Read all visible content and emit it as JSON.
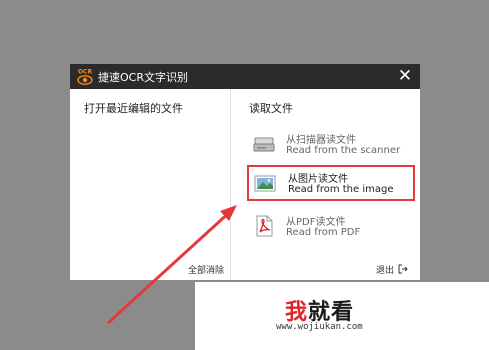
{
  "window": {
    "logo_text": "OCR",
    "title": "捷速OCR文字识别",
    "close_label": "✕"
  },
  "left_pane": {
    "heading": "打开最近编辑的文件",
    "clear_all_label": "全部消除"
  },
  "right_pane": {
    "heading": "读取文件",
    "options": [
      {
        "label_cn": "从扫描器读文件",
        "label_en": "Read from the scanner",
        "icon": "scanner-icon",
        "selected": false
      },
      {
        "label_cn": "从图片读文件",
        "label_en": "Read from the image",
        "icon": "image-icon",
        "selected": true
      },
      {
        "label_cn": "从PDF读文件",
        "label_en": "Read from PDF",
        "icon": "pdf-icon",
        "selected": false
      }
    ],
    "exit_label": "退出"
  },
  "watermark": {
    "brand_first": "我",
    "brand_rest": "就看",
    "url": "www.wojiukan.com"
  },
  "colors": {
    "titlebar": "#2b2b2b",
    "highlight": "#e23a3a",
    "logo_orange": "#f08a1c",
    "backdrop": "#8b8b8b"
  }
}
